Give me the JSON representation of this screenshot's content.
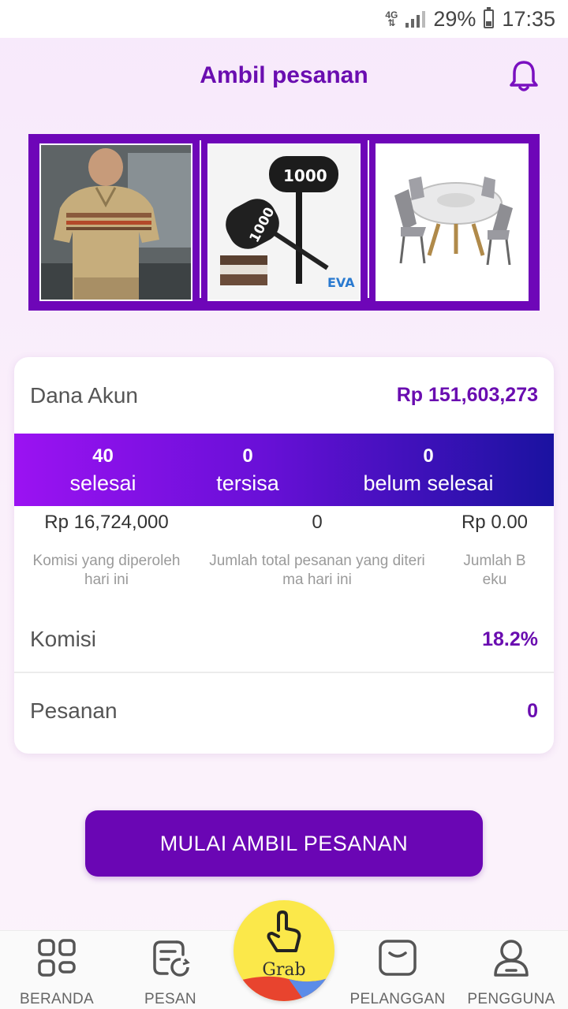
{
  "status_bar": {
    "network": "4G",
    "battery": "29%",
    "time": "17:35"
  },
  "header": {
    "title": "Ambil pesanan"
  },
  "banner": {
    "images": [
      {
        "icon": "polo-shirt-model-image"
      },
      {
        "icon": "inflatable-hammer-image",
        "text": "1000"
      },
      {
        "icon": "dining-table-image"
      }
    ]
  },
  "account": {
    "label": "Dana Akun",
    "value": "Rp 151,603,273"
  },
  "stats": [
    {
      "number": "40",
      "label": "selesai"
    },
    {
      "number": "0",
      "label": "tersisa"
    },
    {
      "number": "0",
      "label": "belum selesai"
    }
  ],
  "amounts": [
    {
      "value": "Rp 16,724,000",
      "desc_line1": "Komisi yang diperoleh",
      "desc_line2": "hari ini"
    },
    {
      "value": "0",
      "desc_line1": "Jumlah total pesanan yang diteri",
      "desc_line2": "ma hari ini"
    },
    {
      "value": "Rp 0.00",
      "desc_line1": "Jumlah B",
      "desc_line2": "eku"
    }
  ],
  "komisi": {
    "label": "Komisi",
    "value": "18.2%"
  },
  "pesanan": {
    "label": "Pesanan",
    "value": "0"
  },
  "cta": {
    "label": "MULAI AMBIL PESANAN"
  },
  "nav": {
    "items": [
      {
        "label": "BERANDA",
        "icon": "grid-icon"
      },
      {
        "label": "PESAN",
        "icon": "order-refresh-icon"
      },
      {
        "label": "PELANGGAN",
        "icon": "frame-icon"
      },
      {
        "label": "PENGGUNA",
        "icon": "user-icon"
      }
    ],
    "grab": {
      "label": "Grab",
      "icon": "tap-hand-icon"
    }
  },
  "colors": {
    "accent": "#6a0db0",
    "button": "#6a06b4",
    "band_start": "#9b12f2",
    "band_end": "#1a12a0"
  }
}
